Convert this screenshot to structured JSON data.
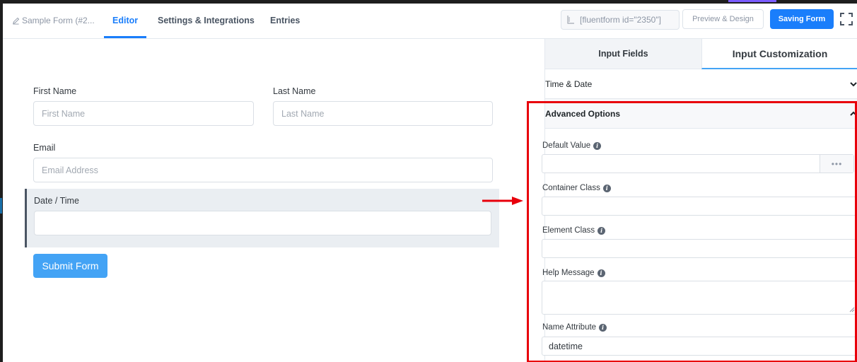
{
  "header": {
    "form_name": "Sample Form (#2...",
    "tabs": [
      {
        "label": "Editor",
        "active": true
      },
      {
        "label": "Settings & Integrations",
        "active": false
      },
      {
        "label": "Entries",
        "active": false
      }
    ],
    "shortcode": "[fluentform id=\"2350\"]",
    "preview_label": "Preview & Design",
    "save_label": "Saving Form"
  },
  "form": {
    "first_name": {
      "label": "First Name",
      "placeholder": "First Name"
    },
    "last_name": {
      "label": "Last Name",
      "placeholder": "Last Name"
    },
    "email": {
      "label": "Email",
      "placeholder": "Email Address"
    },
    "datetime": {
      "label": "Date / Time",
      "placeholder": ""
    },
    "submit_label": "Submit Form"
  },
  "panel": {
    "tabs": [
      {
        "label": "Input Fields",
        "active": false
      },
      {
        "label": "Input Customization",
        "active": true
      }
    ],
    "sections": {
      "time_date": {
        "title": "Time & Date",
        "expanded": false
      },
      "advanced": {
        "title": "Advanced Options",
        "expanded": true
      }
    },
    "fields": {
      "default_value": {
        "label": "Default Value",
        "value": ""
      },
      "container_class": {
        "label": "Container Class",
        "value": ""
      },
      "element_class": {
        "label": "Element Class",
        "value": ""
      },
      "help_message": {
        "label": "Help Message",
        "value": ""
      },
      "name_attribute": {
        "label": "Name Attribute",
        "value": "datetime"
      }
    }
  },
  "colors": {
    "accent": "#1a7efb",
    "submit": "#43a3f5",
    "highlight": "#e8000b"
  }
}
